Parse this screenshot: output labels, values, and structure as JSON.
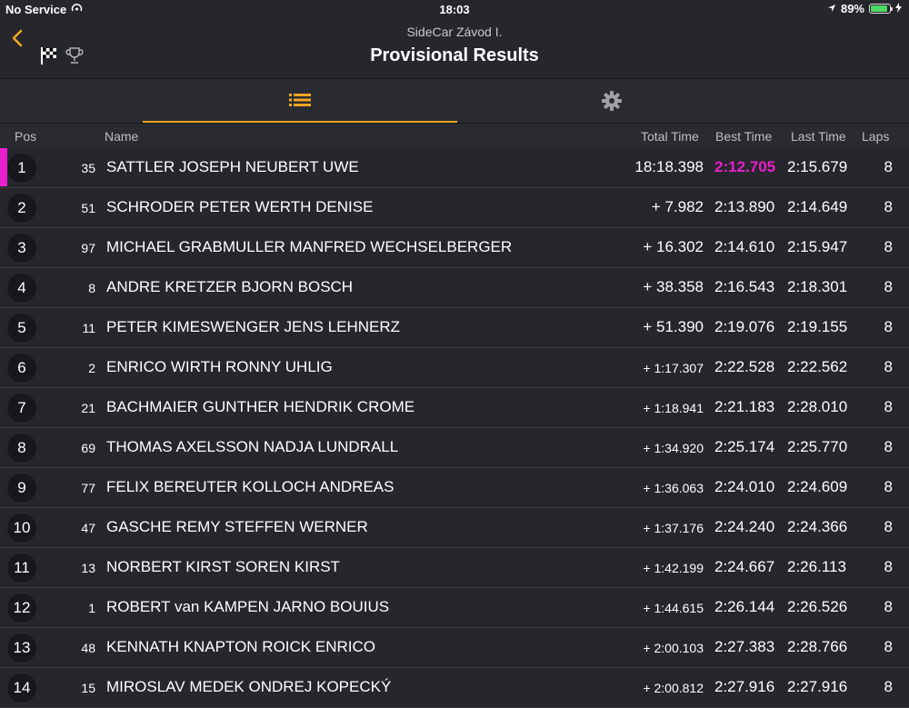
{
  "status_bar": {
    "carrier": "No Service",
    "time": "18:03",
    "battery": "89%",
    "battery_level": 0.89
  },
  "nav": {
    "subtitle": "SideCar Závod I.",
    "title": "Provisional Results"
  },
  "colors": {
    "accent": "#f5a623",
    "fastest_lap": "#e91ecd",
    "background": "#26272c"
  },
  "tabs": [
    {
      "icon": "list-icon",
      "active": true
    },
    {
      "icon": "gear-icon",
      "active": false
    }
  ],
  "columns": {
    "pos": "Pos",
    "name": "Name",
    "total": "Total Time",
    "best": "Best Time",
    "last": "Last Time",
    "laps": "Laps"
  },
  "results": [
    {
      "pos": "1",
      "num": "35",
      "name": "SATTLER JOSEPH NEUBERT UWE",
      "total": "18:18.398",
      "best": "2:12.705",
      "last": "2:15.679",
      "laps": "8"
    },
    {
      "pos": "2",
      "num": "51",
      "name": "SCHRODER PETER WERTH DENISE",
      "total": "+ 7.982",
      "best": "2:13.890",
      "last": "2:14.649",
      "laps": "8"
    },
    {
      "pos": "3",
      "num": "97",
      "name": "MICHAEL GRABMULLER MANFRED WECHSELBERGER",
      "total": "+ 16.302",
      "best": "2:14.610",
      "last": "2:15.947",
      "laps": "8"
    },
    {
      "pos": "4",
      "num": "8",
      "name": "ANDRE KRETZER BJORN BOSCH",
      "total": "+ 38.358",
      "best": "2:16.543",
      "last": "2:18.301",
      "laps": "8"
    },
    {
      "pos": "5",
      "num": "11",
      "name": "PETER KIMESWENGER JENS LEHNERZ",
      "total": "+ 51.390",
      "best": "2:19.076",
      "last": "2:19.155",
      "laps": "8"
    },
    {
      "pos": "6",
      "num": "2",
      "name": "ENRICO WIRTH RONNY UHLIG",
      "total": "+ 1:17.307",
      "best": "2:22.528",
      "last": "2:22.562",
      "laps": "8"
    },
    {
      "pos": "7",
      "num": "21",
      "name": "BACHMAIER GUNTHER HENDRIK CROME",
      "total": "+ 1:18.941",
      "best": "2:21.183",
      "last": "2:28.010",
      "laps": "8"
    },
    {
      "pos": "8",
      "num": "69",
      "name": "THOMAS AXELSSON NADJA LUNDRALL",
      "total": "+ 1:34.920",
      "best": "2:25.174",
      "last": "2:25.770",
      "laps": "8"
    },
    {
      "pos": "9",
      "num": "77",
      "name": "FELIX BEREUTER KOLLOCH ANDREAS",
      "total": "+ 1:36.063",
      "best": "2:24.010",
      "last": "2:24.609",
      "laps": "8"
    },
    {
      "pos": "10",
      "num": "47",
      "name": "GASCHE REMY STEFFEN WERNER",
      "total": "+ 1:37.176",
      "best": "2:24.240",
      "last": "2:24.366",
      "laps": "8"
    },
    {
      "pos": "11",
      "num": "13",
      "name": "NORBERT KIRST SOREN KIRST",
      "total": "+ 1:42.199",
      "best": "2:24.667",
      "last": "2:26.113",
      "laps": "8"
    },
    {
      "pos": "12",
      "num": "1",
      "name": "ROBERT van KAMPEN JARNO BOUIUS",
      "total": "+ 1:44.615",
      "best": "2:26.144",
      "last": "2:26.526",
      "laps": "8"
    },
    {
      "pos": "13",
      "num": "48",
      "name": "KENNATH KNAPTON ROICK ENRICO",
      "total": "+ 2:00.103",
      "best": "2:27.383",
      "last": "2:28.766",
      "laps": "8"
    },
    {
      "pos": "14",
      "num": "15",
      "name": "MIROSLAV MEDEK ONDREJ KOPECKÝ",
      "total": "+ 2:00.812",
      "best": "2:27.916",
      "last": "2:27.916",
      "laps": "8"
    }
  ]
}
